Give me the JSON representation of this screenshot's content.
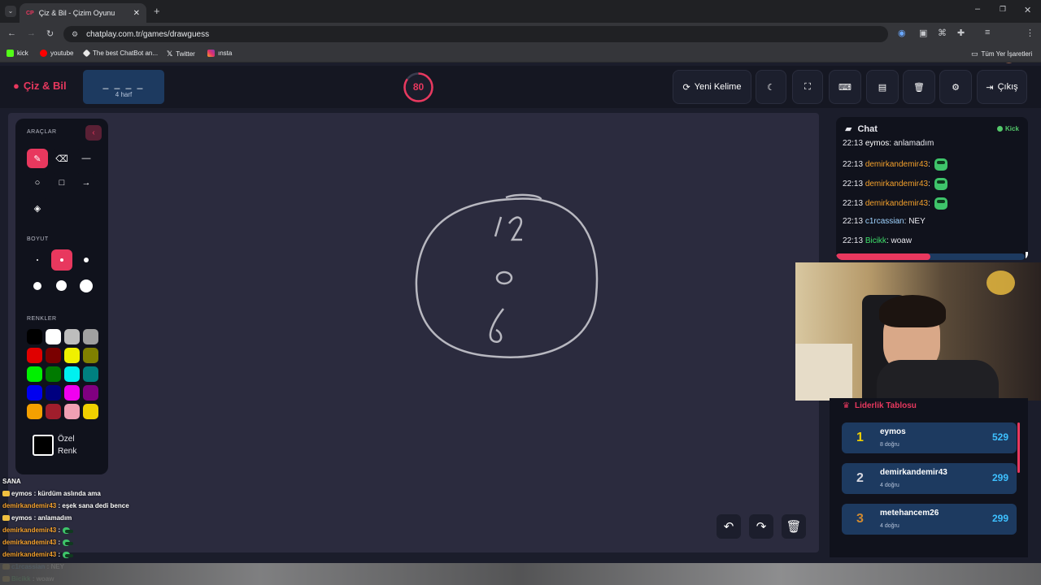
{
  "browser": {
    "tab_title": "Çiz & Bil - Çizim Oyunu",
    "tab_favicon": "CP",
    "url": "chatplay.com.tr/games/drawguess",
    "bookmarks": [
      {
        "label": "kick",
        "icon": "kick-icon"
      },
      {
        "label": "youtube",
        "icon": "youtube-icon"
      },
      {
        "label": "The best ChatBot an...",
        "icon": "chatbot-icon"
      },
      {
        "label": "Twitter",
        "icon": "x-icon"
      },
      {
        "label": "ınsta",
        "icon": "instagram-icon"
      }
    ],
    "all_bookmarks": "Tüm Yer İşaretleri"
  },
  "header": {
    "logo": "Çiz & Bil",
    "word_blanks": "_ _ _ _",
    "word_hint": "4 harf",
    "timer": "80",
    "timer_fraction": 0.85,
    "new_word": "Yeni Kelime",
    "exit": "Çıkış"
  },
  "tools": {
    "section_tools": "ARAÇLAR",
    "section_size": "BOYUT",
    "section_colors": "RENKLER",
    "custom_color": "Özel",
    "custom_color2": "Renk",
    "colors": [
      "#000000",
      "#ffffff",
      "#bdbdbd",
      "#a0a0a0",
      "#e00000",
      "#7a0000",
      "#f0f000",
      "#808000",
      "#00f000",
      "#007a00",
      "#00f0f0",
      "#008080",
      "#0000f0",
      "#000080",
      "#f000f0",
      "#800080",
      "#f4a000",
      "#a01e2c",
      "#f0a0b4",
      "#f0d000"
    ]
  },
  "drawing": {
    "marks": [
      "12",
      "o",
      "6"
    ]
  },
  "chat": {
    "title": "Chat",
    "platform": "Kick",
    "progress": 0.5,
    "messages": [
      {
        "time": "22:13",
        "user": "eymos",
        "text": "anlamadım",
        "color": "#ffffff"
      },
      {
        "time": "22:13",
        "user": "demirkandemir43",
        "text": "",
        "color": "#f4a12c",
        "emote": true
      },
      {
        "time": "22:13",
        "user": "demirkandemir43",
        "text": "",
        "color": "#f4a12c",
        "emote": true
      },
      {
        "time": "22:13",
        "user": "demirkandemir43",
        "text": "",
        "color": "#f4a12c",
        "emote": true
      },
      {
        "time": "22:13",
        "user": "c1rcassian",
        "text": "NEY",
        "color": "#9fd3ff"
      },
      {
        "time": "22:13",
        "user": "Bicikk",
        "text": "woaw",
        "color": "#3ee06a"
      }
    ]
  },
  "leaderboard": {
    "title": "Liderlik Tablosu",
    "rows": [
      {
        "rank": "1",
        "name": "eymos",
        "sub": "8 doğru",
        "score": "529",
        "rank_color": "#f0d000"
      },
      {
        "rank": "2",
        "name": "demirkandemir43",
        "sub": "4 doğru",
        "score": "299",
        "rank_color": "#d8d8e0"
      },
      {
        "rank": "3",
        "name": "metehancem26",
        "sub": "4 doğru",
        "score": "299",
        "rank_color": "#d08a30"
      }
    ]
  },
  "overlay": {
    "heading": "SANA",
    "lines": [
      {
        "user": "eymos",
        "text": ": kürdüm aslında ama"
      },
      {
        "user": "demirkandemir43",
        "text": ": eşek sana dedi bence"
      },
      {
        "user": "eymos",
        "text": ": anlamadım"
      },
      {
        "user": "demirkandemir43",
        "text": ":"
      },
      {
        "user": "demirkandemir43",
        "text": ":"
      },
      {
        "user": "demirkandemir43",
        "text": ":"
      },
      {
        "user": "c1rcassian",
        "text": ": NEY"
      },
      {
        "user": "Bicikk",
        "text": ": woaw"
      }
    ]
  },
  "accent": "#e8385e"
}
